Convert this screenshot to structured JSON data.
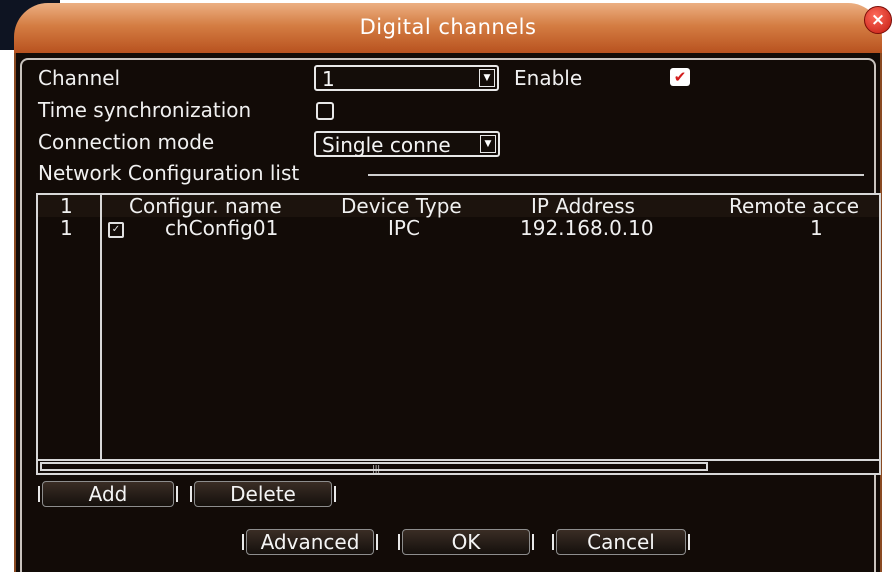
{
  "dialog": {
    "title": "Digital channels",
    "close_glyph": "×"
  },
  "form": {
    "channel_label": "Channel",
    "channel_value": "1",
    "enable_label": "Enable",
    "enable_checked": true,
    "time_sync_label": "Time synchronization",
    "time_sync_checked": false,
    "connection_mode_label": "Connection mode",
    "connection_mode_value": "Single conne",
    "network_list_label": "Network Configuration list"
  },
  "table": {
    "columns": [
      "1",
      "Configur. name",
      "Device Type",
      "IP Address",
      "Remote acce"
    ],
    "rows": [
      {
        "index": "1",
        "checked": true,
        "name": "chConfig01",
        "device_type": "IPC",
        "ip": "192.168.0.10",
        "remote": "1"
      }
    ]
  },
  "buttons": {
    "add": "Add",
    "delete": "Delete",
    "advanced": "Advanced",
    "ok": "OK",
    "cancel": "Cancel"
  },
  "icons": {
    "dropdown_arrow": "dropdown-arrow-icon",
    "check": "check-icon",
    "close": "close-icon"
  },
  "colors": {
    "titlebar_top": "#ecaf82",
    "titlebar_bottom": "#b8521f",
    "dialog_bg": "#120b07",
    "close_red": "#c21a10",
    "check_red": "#d21c1c"
  }
}
